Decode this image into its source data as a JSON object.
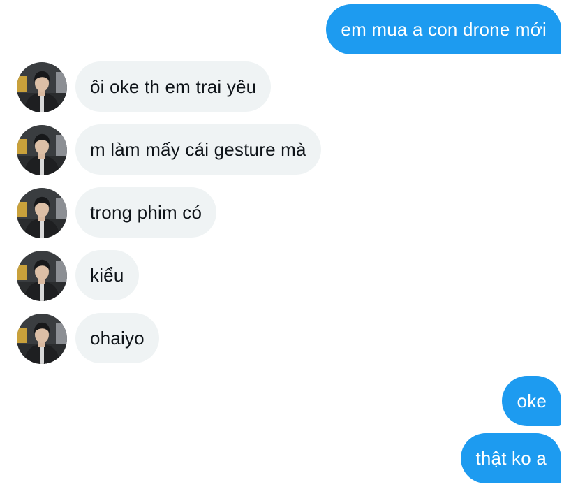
{
  "conversation": {
    "messages": [
      {
        "direction": "sent",
        "text": "em mua a con drone mới"
      },
      {
        "direction": "received",
        "text": "ôi oke th em trai yêu",
        "avatar": "user-avatar"
      },
      {
        "direction": "received",
        "text": "m làm mấy cái gesture mà",
        "avatar": "user-avatar"
      },
      {
        "direction": "received",
        "text": "trong phim có",
        "avatar": "user-avatar"
      },
      {
        "direction": "received",
        "text": "kiểu",
        "avatar": "user-avatar"
      },
      {
        "direction": "received",
        "text": "ohaiyo",
        "avatar": "user-avatar"
      },
      {
        "direction": "sent",
        "text": "oke"
      },
      {
        "direction": "sent",
        "text": "thật ko a"
      }
    ]
  },
  "colors": {
    "sent_bubble": "#1d9bf0",
    "received_bubble": "#eff3f4",
    "received_text": "#0f1419",
    "background": "#ffffff"
  }
}
